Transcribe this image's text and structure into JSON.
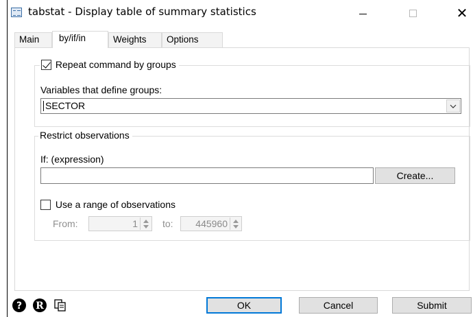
{
  "window": {
    "title": "tabstat - Display table of summary statistics",
    "controls": {
      "minimize": "—",
      "maximize": "☐",
      "close": "✕"
    }
  },
  "tabs": [
    {
      "label": "Main",
      "active": false
    },
    {
      "label": "by/if/in",
      "active": true
    },
    {
      "label": "Weights",
      "active": false
    },
    {
      "label": "Options",
      "active": false
    }
  ],
  "by_group": {
    "repeat_label": "Repeat command by groups",
    "repeat_checked": true,
    "variables_label": "Variables that define groups:",
    "variables_value": "SECTOR"
  },
  "restrict": {
    "legend": "Restrict observations",
    "if_label": "If: (expression)",
    "if_value": "",
    "create_button": "Create...",
    "range_label": "Use a range of observations",
    "range_checked": false,
    "from_label": "From:",
    "from_value": "1",
    "to_label": "to:",
    "to_value": "445960"
  },
  "footer": {
    "icons": [
      "help-icon",
      "info-icon",
      "copy-icon"
    ],
    "ok": "OK",
    "cancel": "Cancel",
    "submit": "Submit"
  }
}
